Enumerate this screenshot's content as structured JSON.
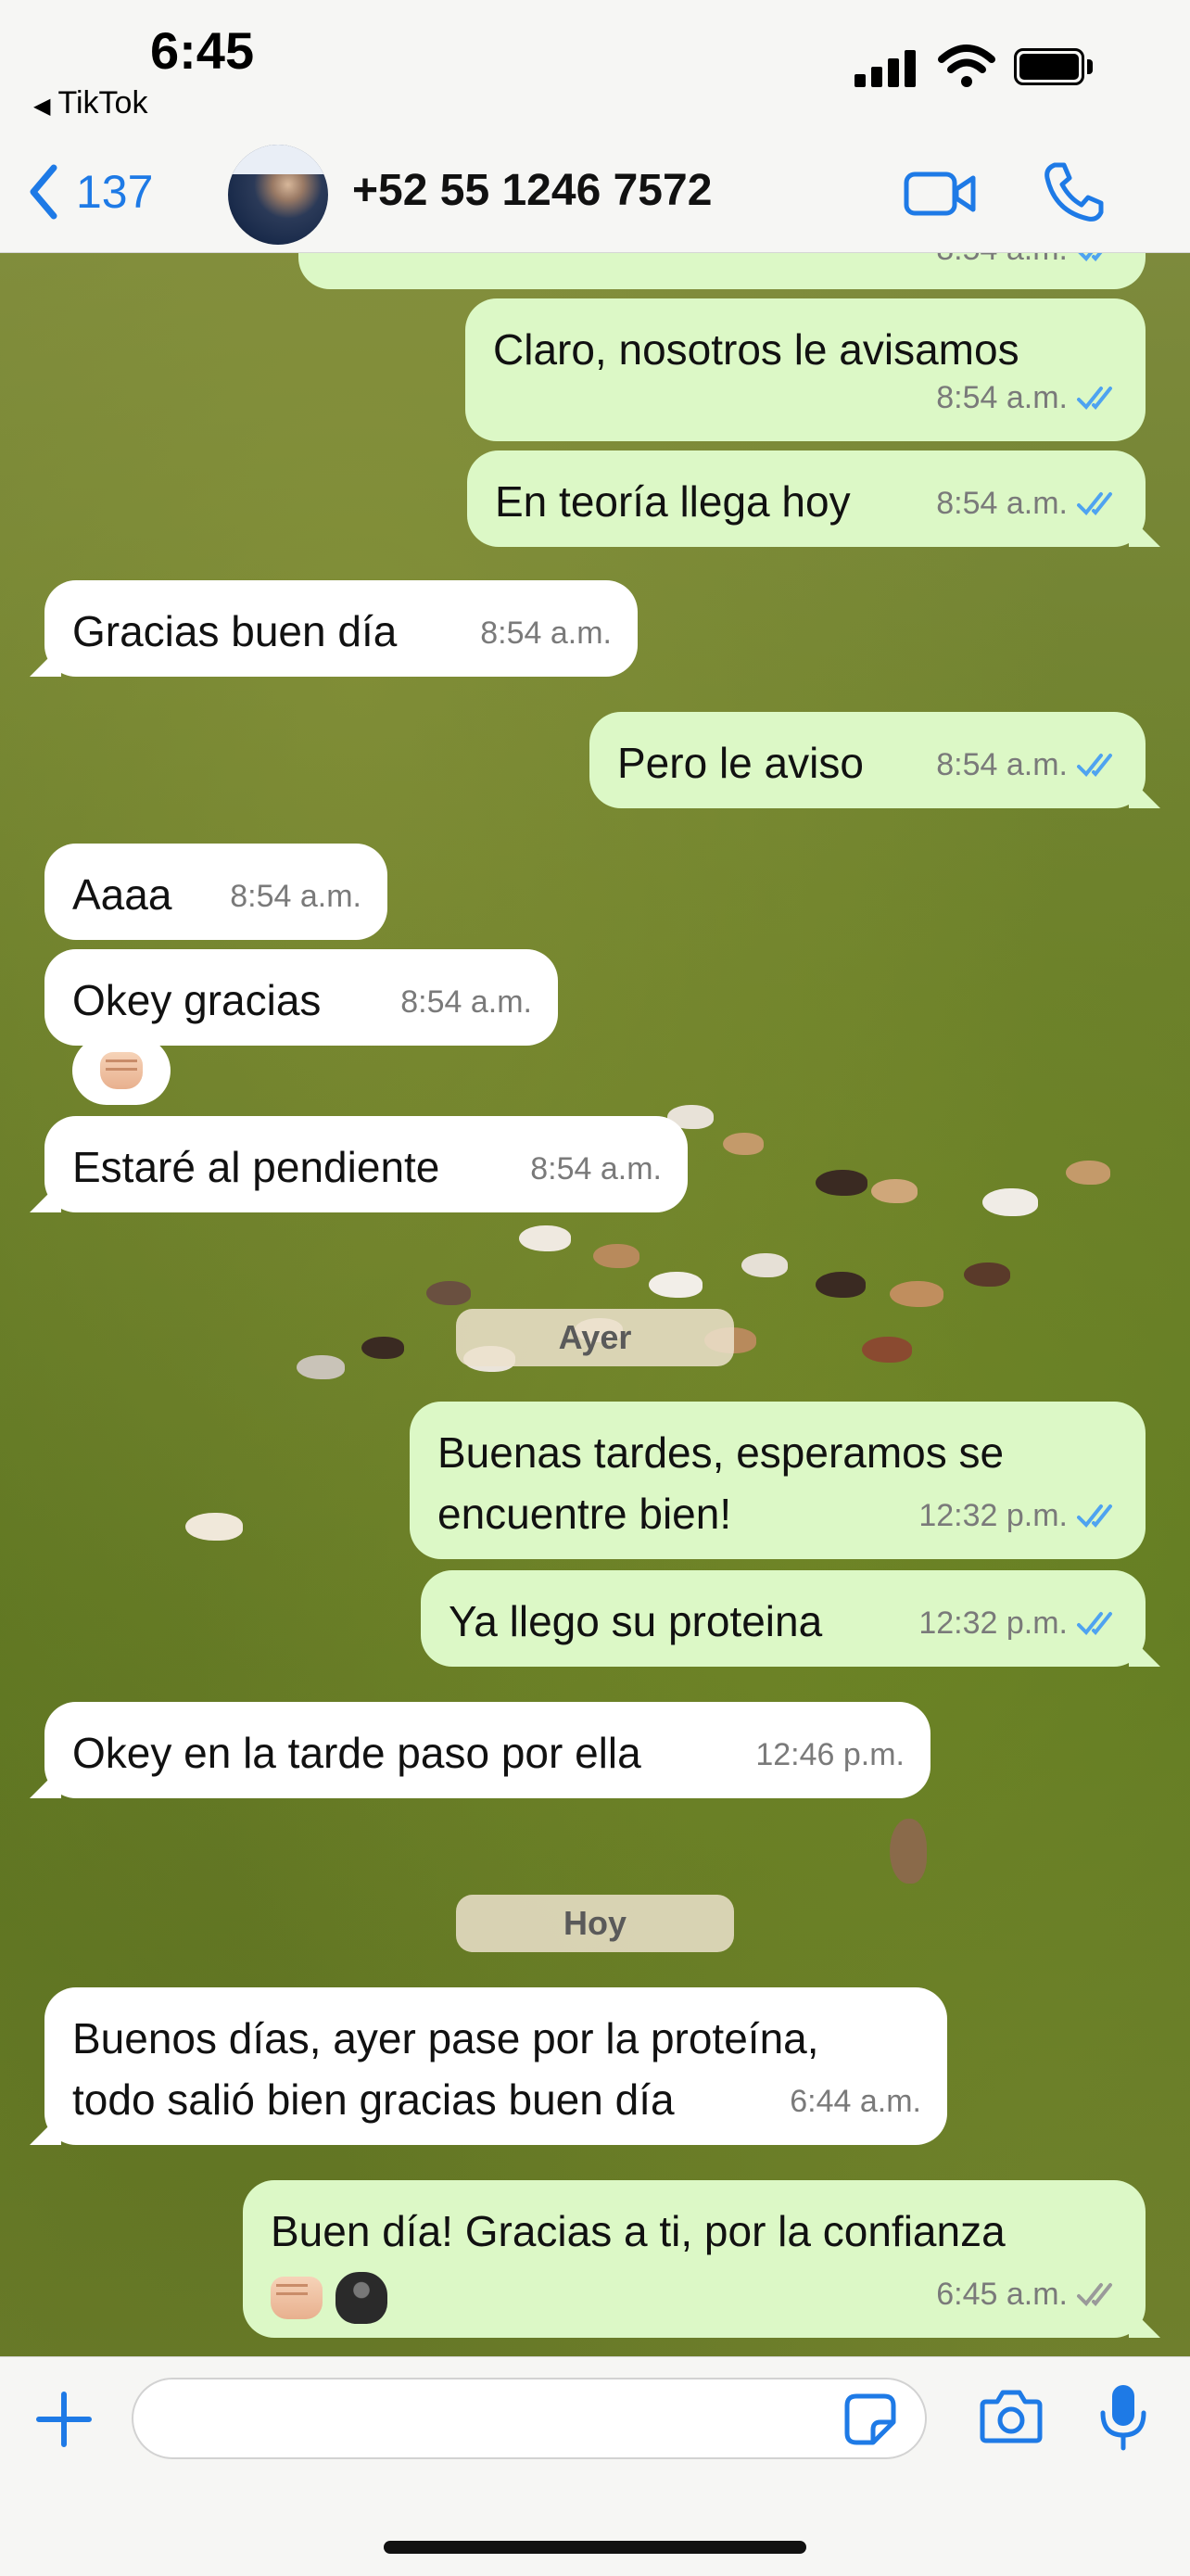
{
  "status_bar": {
    "time": "6:45",
    "back_app": "TikTok"
  },
  "header": {
    "back_count": "137",
    "contact": "+52 55 1246 7572"
  },
  "messages": [
    {
      "text": "Claro, nosotros le avisamos",
      "time": "8:54 a.m.",
      "direction": "out",
      "read": true
    },
    {
      "text": "En teoría llega hoy",
      "time": "8:54 a.m.",
      "direction": "out",
      "read": true
    },
    {
      "text": "Gracias buen día",
      "time": "8:54 a.m.",
      "direction": "in"
    },
    {
      "text": "Pero le aviso",
      "time": "8:54 a.m.",
      "direction": "out",
      "read": true
    },
    {
      "text": "Aaaa",
      "time": "8:54 a.m.",
      "direction": "in"
    },
    {
      "text": "Okey gracias",
      "time": "8:54 a.m.",
      "direction": "in"
    },
    {
      "text": "Estaré al pendiente",
      "time": "8:54 a.m.",
      "direction": "in"
    },
    {
      "text": "Buenas tardes, esperamos se encuentre bien!",
      "time": "12:32 p.m.",
      "direction": "out",
      "read": true
    },
    {
      "text": "Ya llego su proteina",
      "time": "12:32 p.m.",
      "direction": "out",
      "read": true
    },
    {
      "text": "Okey en la tarde paso por ella",
      "time": "12:46 p.m.",
      "direction": "in"
    },
    {
      "text": "Buenos días, ayer pase por la proteína, todo salió bien gracias buen día",
      "time": "6:44 a.m.",
      "direction": "in"
    },
    {
      "text": "Buen día! Gracias a ti, por la confianza",
      "time": "6:45 a.m.",
      "direction": "out",
      "read": false
    }
  ],
  "top_partial_time": "8:54 a.m.",
  "day_separators": [
    "Ayer",
    "Hoy"
  ],
  "reaction_icon": "oncoming-fist",
  "last_message_emojis": [
    "oncoming-fist",
    "gorilla"
  ],
  "colors": {
    "accent": "#1e7ae6",
    "outgoing_bubble": "#dcf8c6",
    "incoming_bubble": "#ffffff",
    "read_ticks": "#4fa3f0",
    "delivered_ticks": "#9a9a9a"
  }
}
